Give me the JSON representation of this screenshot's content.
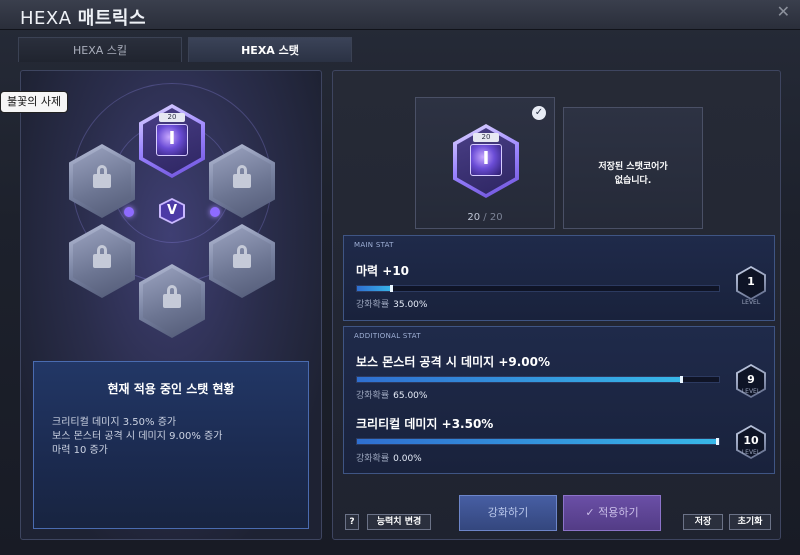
{
  "window": {
    "title_prefix": "HEXA",
    "title_main": "매트릭스",
    "close_glyph": "✕"
  },
  "tabs": [
    {
      "label": "HEXA 스킬",
      "active": false
    },
    {
      "label": "HEXA 스탯",
      "active": true
    }
  ],
  "tooltip": "불꽃의 사제",
  "core": {
    "level_badge": "20",
    "glyph": "I",
    "center_glyph": "V"
  },
  "current_stats": {
    "title": "현재 적용 중인 스탯 현황",
    "lines": [
      "크리티컬 데미지 3.50% 증가",
      "보스 몬스터 공격 시 데미지 9.00% 증가",
      "마력 10 증가"
    ]
  },
  "slot": {
    "level_badge": "20",
    "count_current": "20",
    "count_sep": " / ",
    "count_max": "20",
    "saved_line1": "저장된 스탯코어가",
    "saved_line2": "없습니다."
  },
  "main_stat": {
    "header": "MAIN STAT",
    "name": "마력 +10",
    "prob_label": "강화확률",
    "prob_value": "35.00%",
    "level": "1",
    "level_label": "LEVEL",
    "progress": 0.1
  },
  "additional_stat": {
    "header": "ADDITIONAL STAT",
    "items": [
      {
        "name": "보스 몬스터 공격 시 데미지 +9.00%",
        "prob_label": "강화확률",
        "prob_value": "65.00%",
        "level": "9",
        "level_label": "LEVEL",
        "progress": 0.9
      },
      {
        "name": "크리티컬 데미지 +3.50%",
        "prob_label": "강화확률",
        "prob_value": "0.00%",
        "level": "10",
        "level_label": "LEVEL",
        "progress": 1.0
      }
    ]
  },
  "buttons": {
    "help": "?",
    "reset_stat": "능력치 변경",
    "enhance": "강화하기",
    "apply": "✓ 적용하기",
    "save": "저장",
    "init": "초기화"
  },
  "colors": {
    "accent_purple": "#8e6bff",
    "bar_fill": "#38b8e8",
    "panel_border": "#3e4560"
  }
}
